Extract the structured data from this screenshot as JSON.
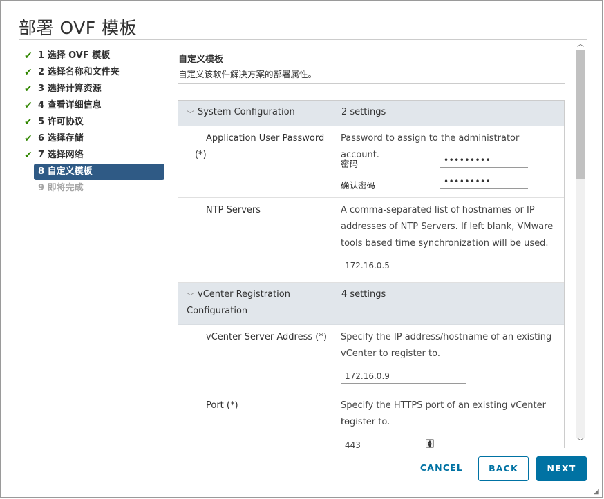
{
  "dialog": {
    "title": "部署 OVF 模板"
  },
  "steps": [
    {
      "label": "1 选择 OVF 模板",
      "state": "done"
    },
    {
      "label": "2 选择名称和文件夹",
      "state": "done"
    },
    {
      "label": "3 选择计算资源",
      "state": "done"
    },
    {
      "label": "4 查看详细信息",
      "state": "done"
    },
    {
      "label": "5 许可协议",
      "state": "done"
    },
    {
      "label": "6 选择存储",
      "state": "done"
    },
    {
      "label": "7 选择网络",
      "state": "done"
    },
    {
      "label": "8 自定义模板",
      "state": "active"
    },
    {
      "label": "9 即将完成",
      "state": "future"
    }
  ],
  "content": {
    "title": "自定义模板",
    "subtitle": "自定义该软件解决方案的部署属性。"
  },
  "groups": {
    "system": {
      "name": "System Configuration",
      "count": "2 settings"
    },
    "vcenter": {
      "name_line1": "vCenter Registration",
      "name_line2": "Configuration",
      "count": "4 settings"
    }
  },
  "rows": {
    "app_password": {
      "label_line1": "Application User Password",
      "label_line2": "(*)",
      "desc": "Password to assign to the administrator account.",
      "field1_label": "密码",
      "field1_value": "•••••••••",
      "field2_label": "确认密码",
      "field2_value": "•••••••••"
    },
    "ntp": {
      "label": "NTP Servers",
      "desc_line1": "A comma-separated list of hostnames or IP",
      "desc_line2": "addresses of NTP Servers. If left blank, VMware",
      "desc_line3": "tools based time synchronization will be used.",
      "value": "172.16.0.5"
    },
    "vc_address": {
      "label": "vCenter Server Address (*)",
      "desc_line1": "Specify the IP address/hostname of an existing",
      "desc_line2": "vCenter to register to.",
      "value": "172.16.0.9"
    },
    "port": {
      "label": "Port (*)",
      "desc_line1": "Specify the HTTPS port of an existing vCenter to",
      "desc_line2": "register to.",
      "value": "443"
    }
  },
  "footer": {
    "cancel": "CANCEL",
    "back": "BACK",
    "next": "NEXT"
  },
  "colors": {
    "accent": "#0072a3",
    "active_step": "#2f5a85",
    "check": "#318700",
    "group_header": "#e1e6eb"
  }
}
